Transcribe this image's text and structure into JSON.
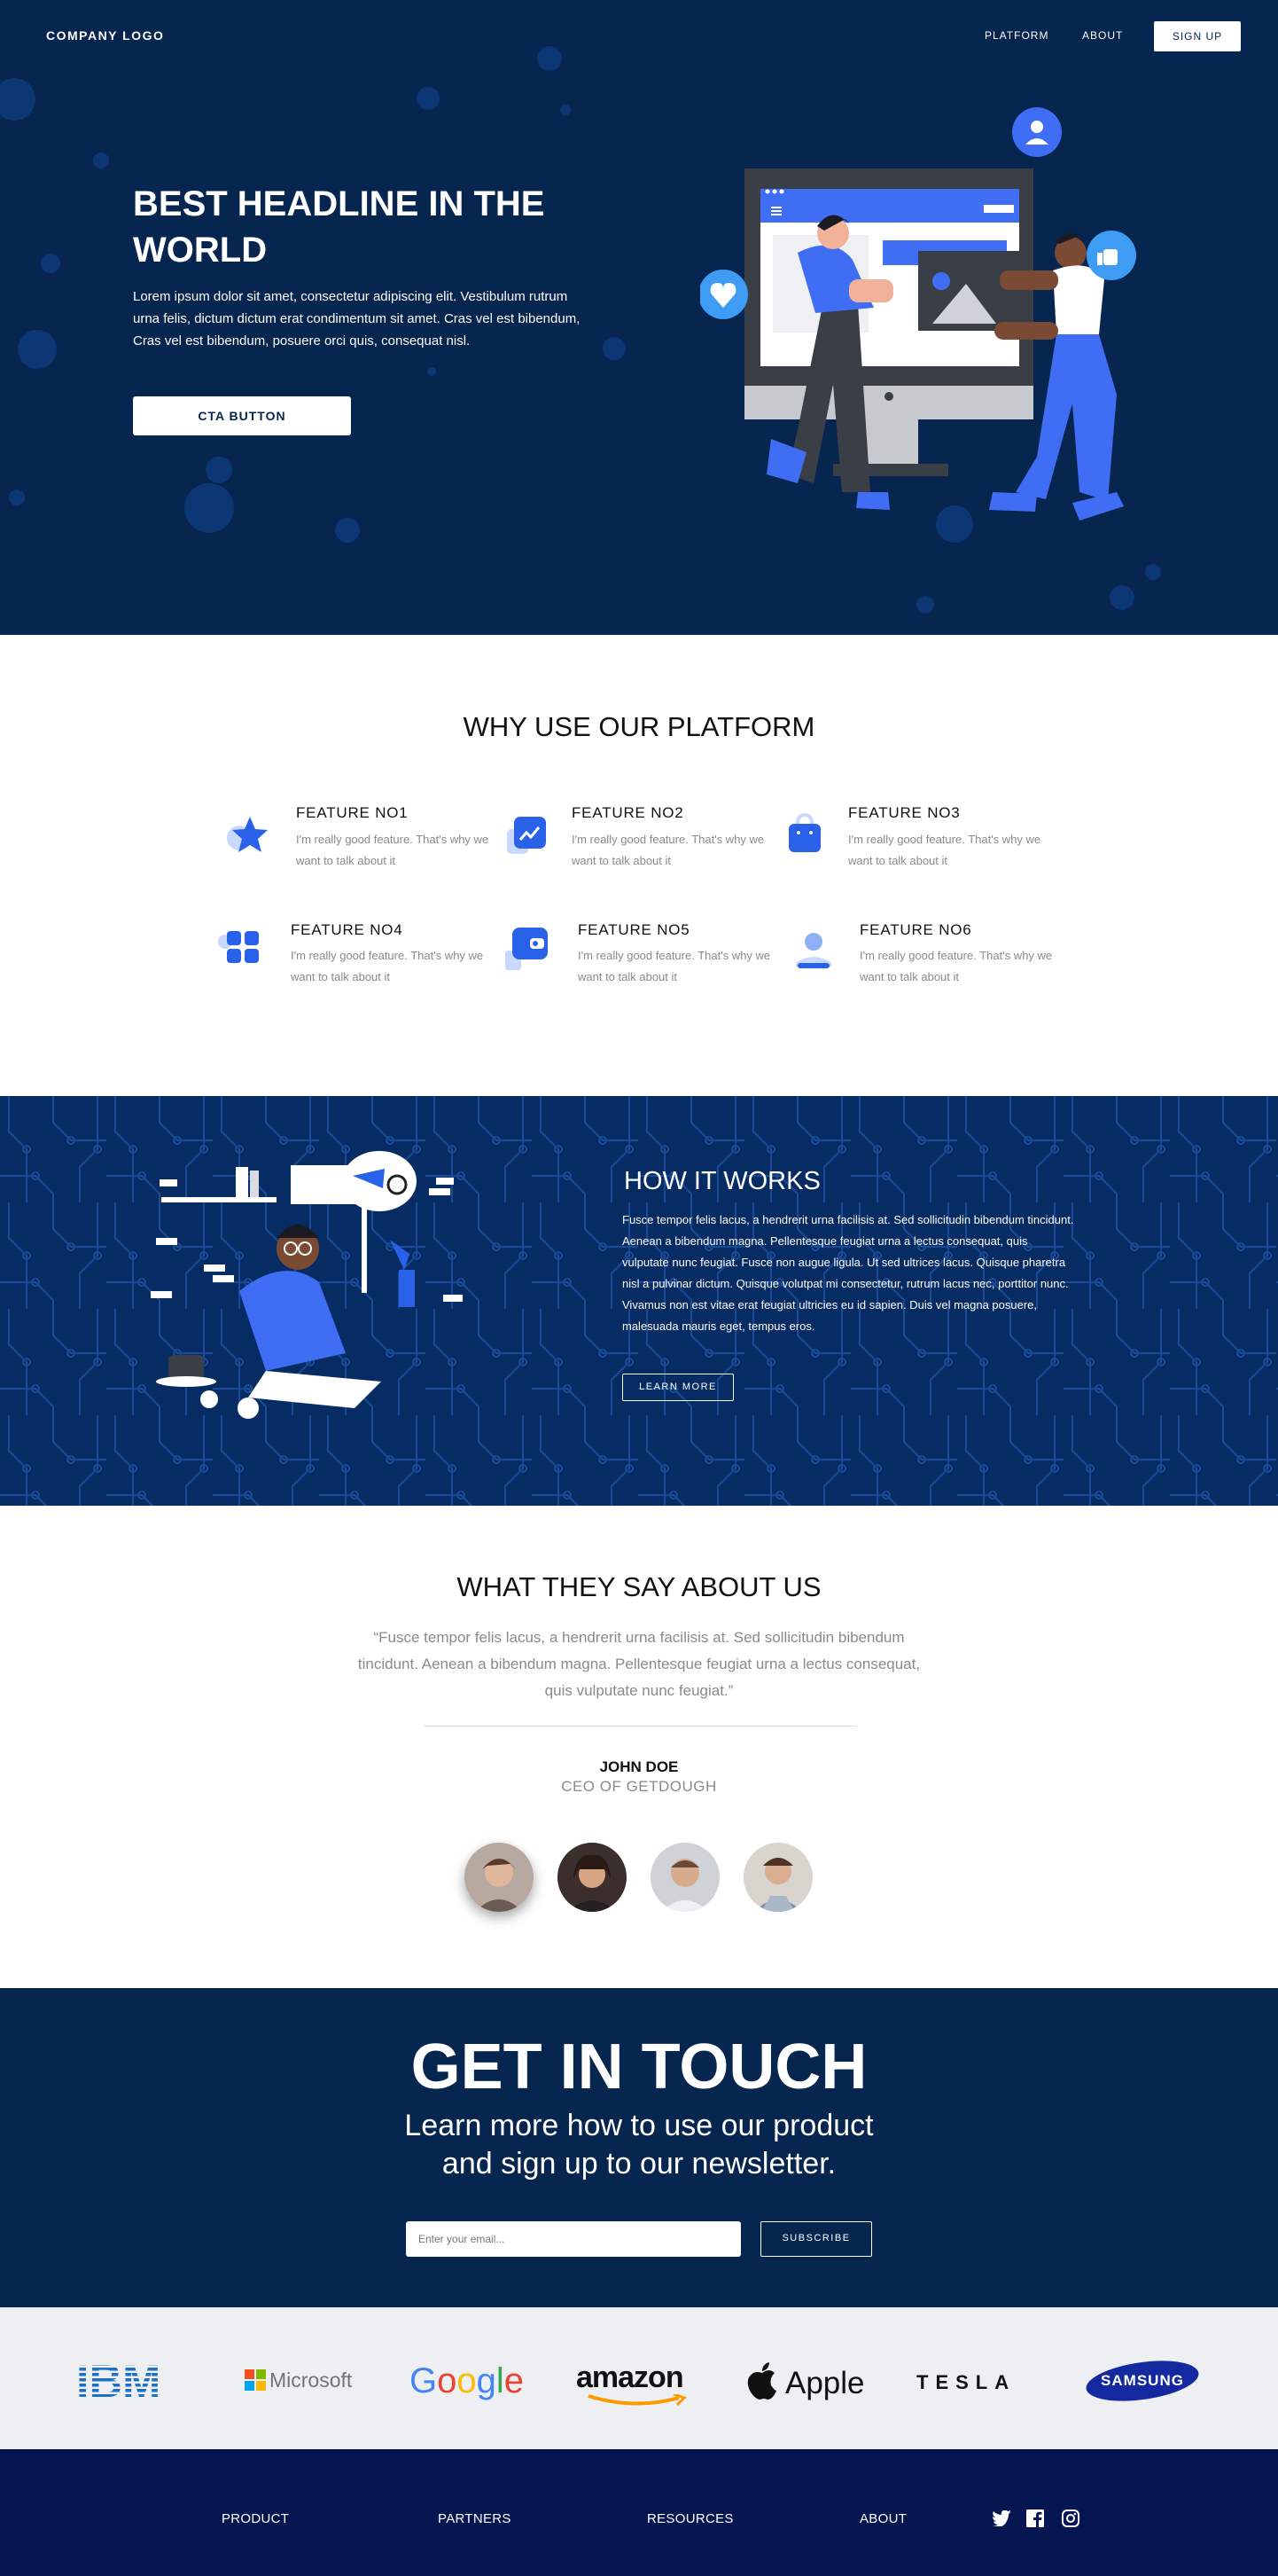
{
  "nav": {
    "logo": "COMPANY LOGO",
    "links": [
      "PLATFORM",
      "ABOUT"
    ],
    "signup": "SIGN UP"
  },
  "hero": {
    "title": "BEST HEADLINE IN THE WORLD",
    "text": "Lorem ipsum dolor sit amet, consectetur adipiscing elit. Vestibulum rutrum urna felis, dictum dictum erat condimentum sit amet. Cras vel est bibendum, Cras vel est bibendum, posuere orci quis, consequat nisl.",
    "cta": "CTA BUTTON"
  },
  "features": {
    "title": "WHY USE OUR PLATFORM",
    "items": [
      {
        "title": "FEATURE NO1",
        "desc": "I'm really good feature. That's why we want to talk about it",
        "icon": "star-icon"
      },
      {
        "title": "FEATURE NO2",
        "desc": "I'm really good feature. That's why we want to talk about it",
        "icon": "chart-icon"
      },
      {
        "title": "FEATURE NO3",
        "desc": "I'm really good feature. That's why we want to talk about it",
        "icon": "bag-icon"
      },
      {
        "title": "FEATURE NO4",
        "desc": "I'm really good feature. That's why we want to talk about it",
        "icon": "grid-icon"
      },
      {
        "title": "FEATURE NO5",
        "desc": "I'm really good feature. That's why we want to talk about it",
        "icon": "wallet-icon"
      },
      {
        "title": "FEATURE NO6",
        "desc": "I'm really good feature. That's why we want to talk about it",
        "icon": "user-icon"
      }
    ]
  },
  "how": {
    "title": "HOW IT WORKS",
    "text": "Fusce tempor felis lacus, a hendrerit urna facilisis at. Sed sollicitudin bibendum tincidunt. Aenean a bibendum magna. Pellentesque feugiat urna a lectus consequat, quis vulputate nunc feugiat. Fusce non augue ligula. Ut sed ultrices lacus. Quisque pharetra nisl a pulvinar dictum. Quisque volutpat mi consectetur, rutrum lacus nec, porttitor nunc. Vivamus non est vitae erat feugiat ultricies eu id sapien. Duis vel magna posuere, malesuada mauris eget, tempus eros.",
    "button": "LEARN MORE"
  },
  "testimonial": {
    "title": "WHAT THEY SAY ABOUT US",
    "quote": "“Fusce tempor felis lacus, a hendrerit urna facilisis at. Sed sollicitudin bibendum tincidunt. Aenean a bibendum magna. Pellentesque feugiat urna a lectus consequat, quis vulputate nunc feugiat.”",
    "name": "JOHN DOE",
    "role": "CEO OF GETDOUGH"
  },
  "contact": {
    "title": "GET IN TOUCH",
    "subtitle_line1": "Learn more how to use our product",
    "subtitle_line2": "and sign up to our newsletter.",
    "email_placeholder": "Enter your email...",
    "subscribe": "SUBSCRIBE"
  },
  "brands": [
    "IBM",
    "Microsoft",
    "Google",
    "amazon",
    "Apple",
    "TESLA",
    "SAMSUNG"
  ],
  "footer": {
    "links": [
      "PRODUCT",
      "PARTNERS",
      "RESOURCES",
      "ABOUT"
    ],
    "social": [
      "twitter-icon",
      "facebook-icon",
      "instagram-icon"
    ]
  },
  "colors": {
    "navy": "#06254f",
    "blue": "#3f6ef5",
    "footer": "#041550",
    "logos_bg": "#eeeff2"
  }
}
